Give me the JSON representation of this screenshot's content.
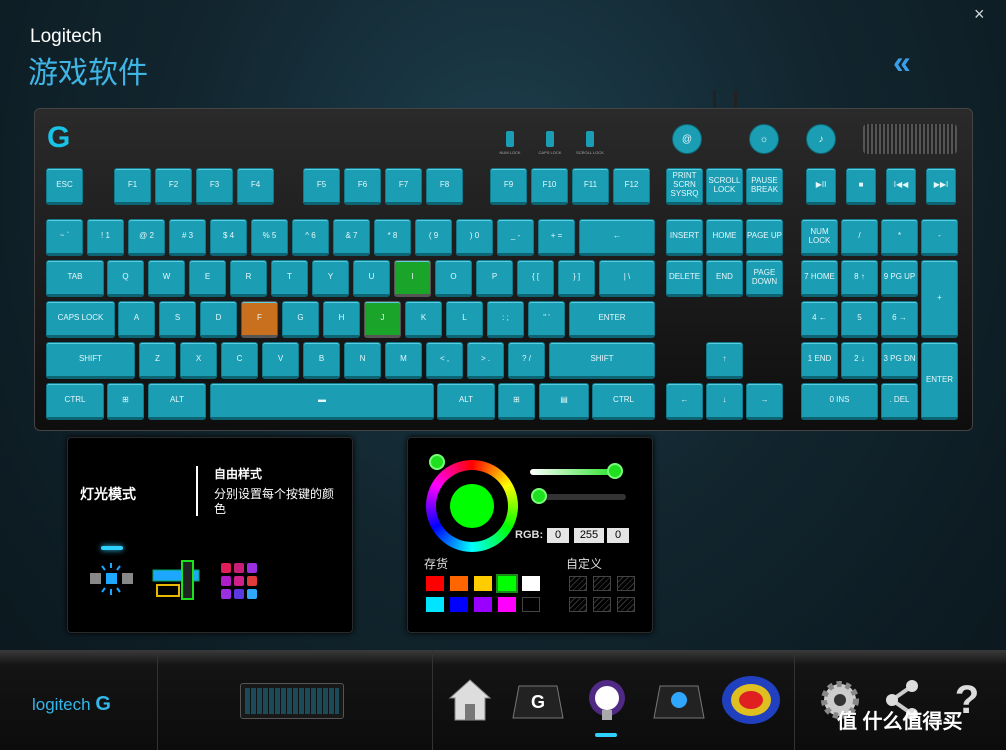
{
  "window": {
    "brand": "Logitech",
    "subtitle": "游戏软件",
    "close": "×",
    "collapse": "«"
  },
  "keyboard": {
    "indicators": [
      "NUM LOCK",
      "CAPS LOCK",
      "SCROLL LOCK"
    ],
    "round_buttons": [
      "@",
      "☼",
      "♪"
    ],
    "keys": [
      [
        "ESC",
        "F1",
        "F2",
        "F3",
        "F4",
        "F5",
        "F6",
        "F7",
        "F8",
        "F9",
        "F10",
        "F11",
        "F12",
        "PRINT SCRN SYSRQ",
        "SCROLL LOCK",
        "PAUSE BREAK",
        "▶II",
        "■",
        "I◀◀",
        "▶▶I"
      ],
      [
        "~ `",
        "! 1",
        "@ 2",
        "# 3",
        "$ 4",
        "% 5",
        "^ 6",
        "& 7",
        "* 8",
        "( 9",
        ") 0",
        "_ -",
        "+ =",
        "←",
        "INSERT",
        "HOME",
        "PAGE UP",
        "NUM LOCK",
        "/",
        "*",
        "-"
      ],
      [
        "TAB",
        "Q",
        "W",
        "E",
        "R",
        "T",
        "Y",
        "U",
        "I",
        "O",
        "P",
        "{ [",
        "} ]",
        "| \\",
        "DELETE",
        "END",
        "PAGE DOWN",
        "7 HOME",
        "8 ↑",
        "9 PG UP",
        "+"
      ],
      [
        "CAPS LOCK",
        "A",
        "S",
        "D",
        "F",
        "G",
        "H",
        "J",
        "K",
        "L",
        ": ;",
        "\" '",
        "ENTER",
        "4 ←",
        "5",
        "6 →"
      ],
      [
        "SHIFT",
        "Z",
        "X",
        "C",
        "V",
        "B",
        "N",
        "M",
        "< ,",
        "> .",
        "? /",
        "SHIFT",
        "↑",
        "1 END",
        "2 ↓",
        "3 PG DN",
        "ENTER"
      ],
      [
        "CTRL",
        "⊞",
        "ALT",
        "▬",
        "ALT",
        "⊞",
        "▤",
        "CTRL",
        "←",
        "↓",
        "→",
        "0 INS",
        ". DEL"
      ]
    ],
    "highlighted": {
      "I": "#1aa52a",
      "J": "#1aa52a",
      "F": "#c8701e"
    }
  },
  "lighting_panel": {
    "title": "灯光模式",
    "mode_name": "自由样式",
    "mode_desc": "分别设置每个按键的颜色"
  },
  "color_panel": {
    "rgb_label": "RGB:",
    "r": "0",
    "g": "255",
    "b": "0",
    "stock_label": "存货",
    "custom_label": "自定义",
    "stock_colors": [
      "#ff0000",
      "#ff6600",
      "#ffcc00",
      "#00ff00",
      "#ffffff",
      "#00e5ff",
      "#0000ff",
      "#9900ff",
      "#ff00ff",
      "#000000"
    ],
    "selected_color": "#00ff00"
  },
  "bottom": {
    "logo": "logitech",
    "watermark": "值 什么值得买",
    "nav": [
      "home-icon",
      "g-key-icon",
      "lighting-icon",
      "arx-icon",
      "heatmap-icon",
      "settings-icon",
      "share-icon",
      "help-icon"
    ]
  }
}
